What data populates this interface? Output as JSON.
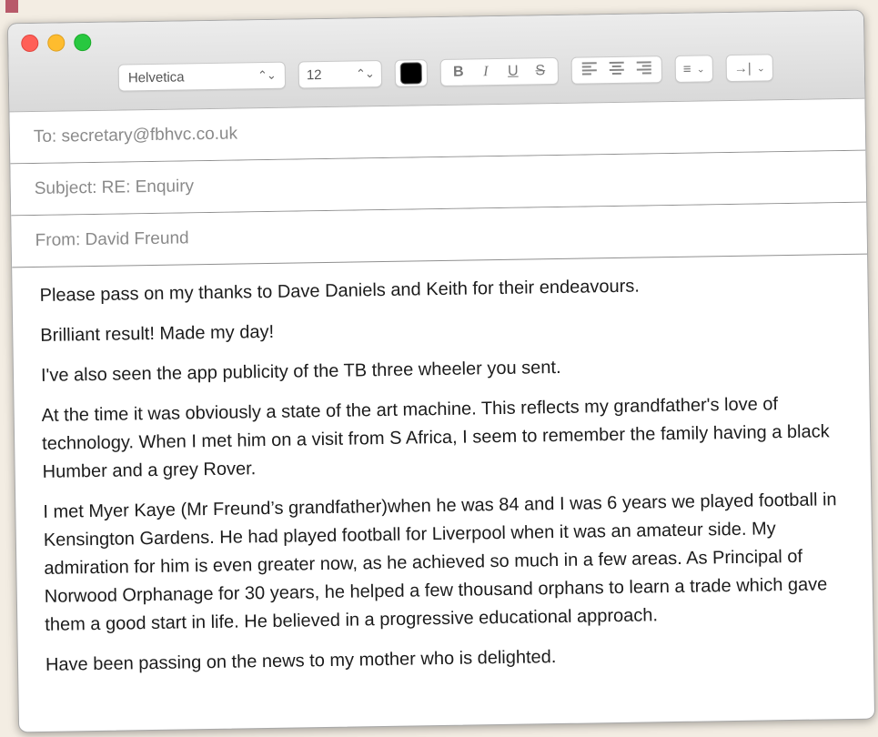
{
  "window": {
    "traffic_lights": [
      "close-button",
      "minimize-button",
      "zoom-button"
    ]
  },
  "toolbar": {
    "font": "Helvetica",
    "size": "12",
    "text_color": "#000000",
    "bold": "B",
    "italic": "I",
    "underline": "U",
    "strike": "S"
  },
  "email": {
    "to": "To: secretary@fbhvc.co.uk",
    "subject": "Subject: RE: Enquiry",
    "from": "From: David Freund"
  },
  "body": {
    "p1": "Please pass on my thanks to Dave Daniels and Keith for their endeavours.",
    "p2": "Brilliant result! Made my day!",
    "p3": "I've also seen the app publicity of the TB three wheeler you sent.",
    "p4": "At the time it was obviously a state of the art machine. This reflects my grandfather's love of technology. When I met him on a visit from S Africa, I seem to remember the family having a black Humber and a grey Rover.",
    "p5": "I met Myer Kaye (Mr Freund’s grandfather)when he was 84 and I was 6 years we played football in Kensington Gardens. He had played football for Liverpool when it was an amateur side. My admiration for him is even greater now, as he achieved so much in a few areas. As Principal of Norwood Orphanage for 30 years, he helped a few thousand orphans to learn a trade which gave them a good start in life. He believed in a progressive educational approach.",
    "p6": "Have been passing on the news to my mother who is delighted."
  },
  "colors": {
    "close": "#ff5f57",
    "minimize": "#febc2e",
    "zoom": "#28c840",
    "background": "#f3ede3",
    "accent_bar": "#b85a6a"
  }
}
